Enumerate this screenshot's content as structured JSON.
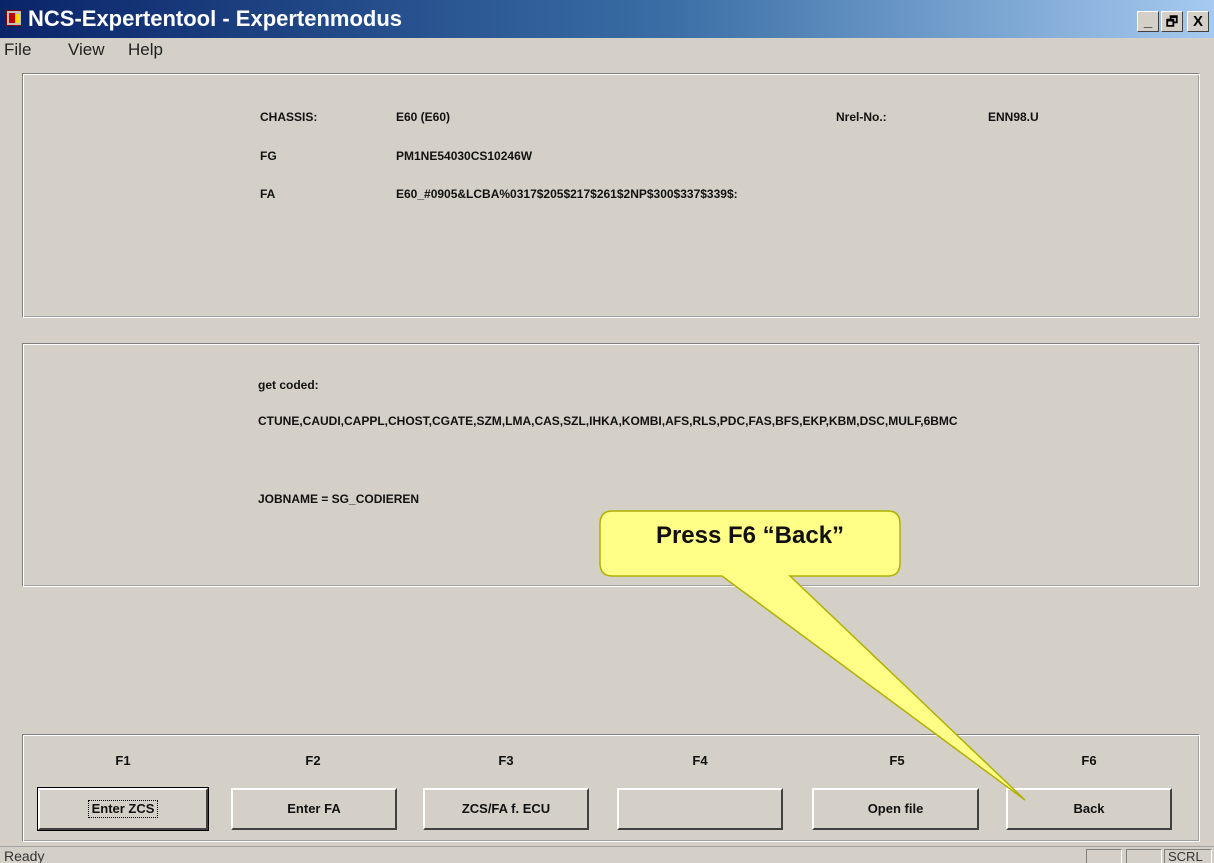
{
  "window": {
    "title": "NCS-Expertentool - Expertenmodus",
    "minimize_label": "_",
    "restore_label": "🗗",
    "close_label": "X"
  },
  "menu": {
    "items": [
      "File",
      "View",
      "Help"
    ]
  },
  "vehicle_panel": {
    "chassis_label": "CHASSIS:",
    "chassis_value": "E60 (E60)",
    "nrel_label": "Nrel-No.:",
    "nrel_value": "ENN98.U",
    "fg_label": "FG",
    "fg_value": "PM1NE54030CS10246W",
    "fa_label": "FA",
    "fa_value": "E60_#0905&LCBA%0317$205$217$261$2NP$300$337$339$:"
  },
  "job_panel": {
    "get_coded_label": "get coded:",
    "modules_value": "CTUNE,CAUDI,CAPPL,CHOST,CGATE,SZM,LMA,CAS,SZL,IHKA,KOMBI,AFS,RLS,PDC,FAS,BFS,EKP,KBM,DSC,MULF,6BMC",
    "jobname_text": "JOBNAME = SG_CODIEREN"
  },
  "function_keys": [
    {
      "key": "F1",
      "label": "Enter ZCS"
    },
    {
      "key": "F2",
      "label": "Enter FA"
    },
    {
      "key": "F3",
      "label": "ZCS/FA f. ECU"
    },
    {
      "key": "F4",
      "label": ""
    },
    {
      "key": "F5",
      "label": "Open file"
    },
    {
      "key": "F6",
      "label": "Back"
    }
  ],
  "callout": {
    "text": "Press F6 “Back”",
    "fill_color": "#ffff88",
    "border_color": "#b0b000"
  },
  "status": {
    "text": "Ready",
    "indicator": "SCRL"
  },
  "colors": {
    "title_gradient_start": "#0a246a",
    "title_gradient_end": "#a6caf0",
    "window_background": "#d4d0c8"
  }
}
